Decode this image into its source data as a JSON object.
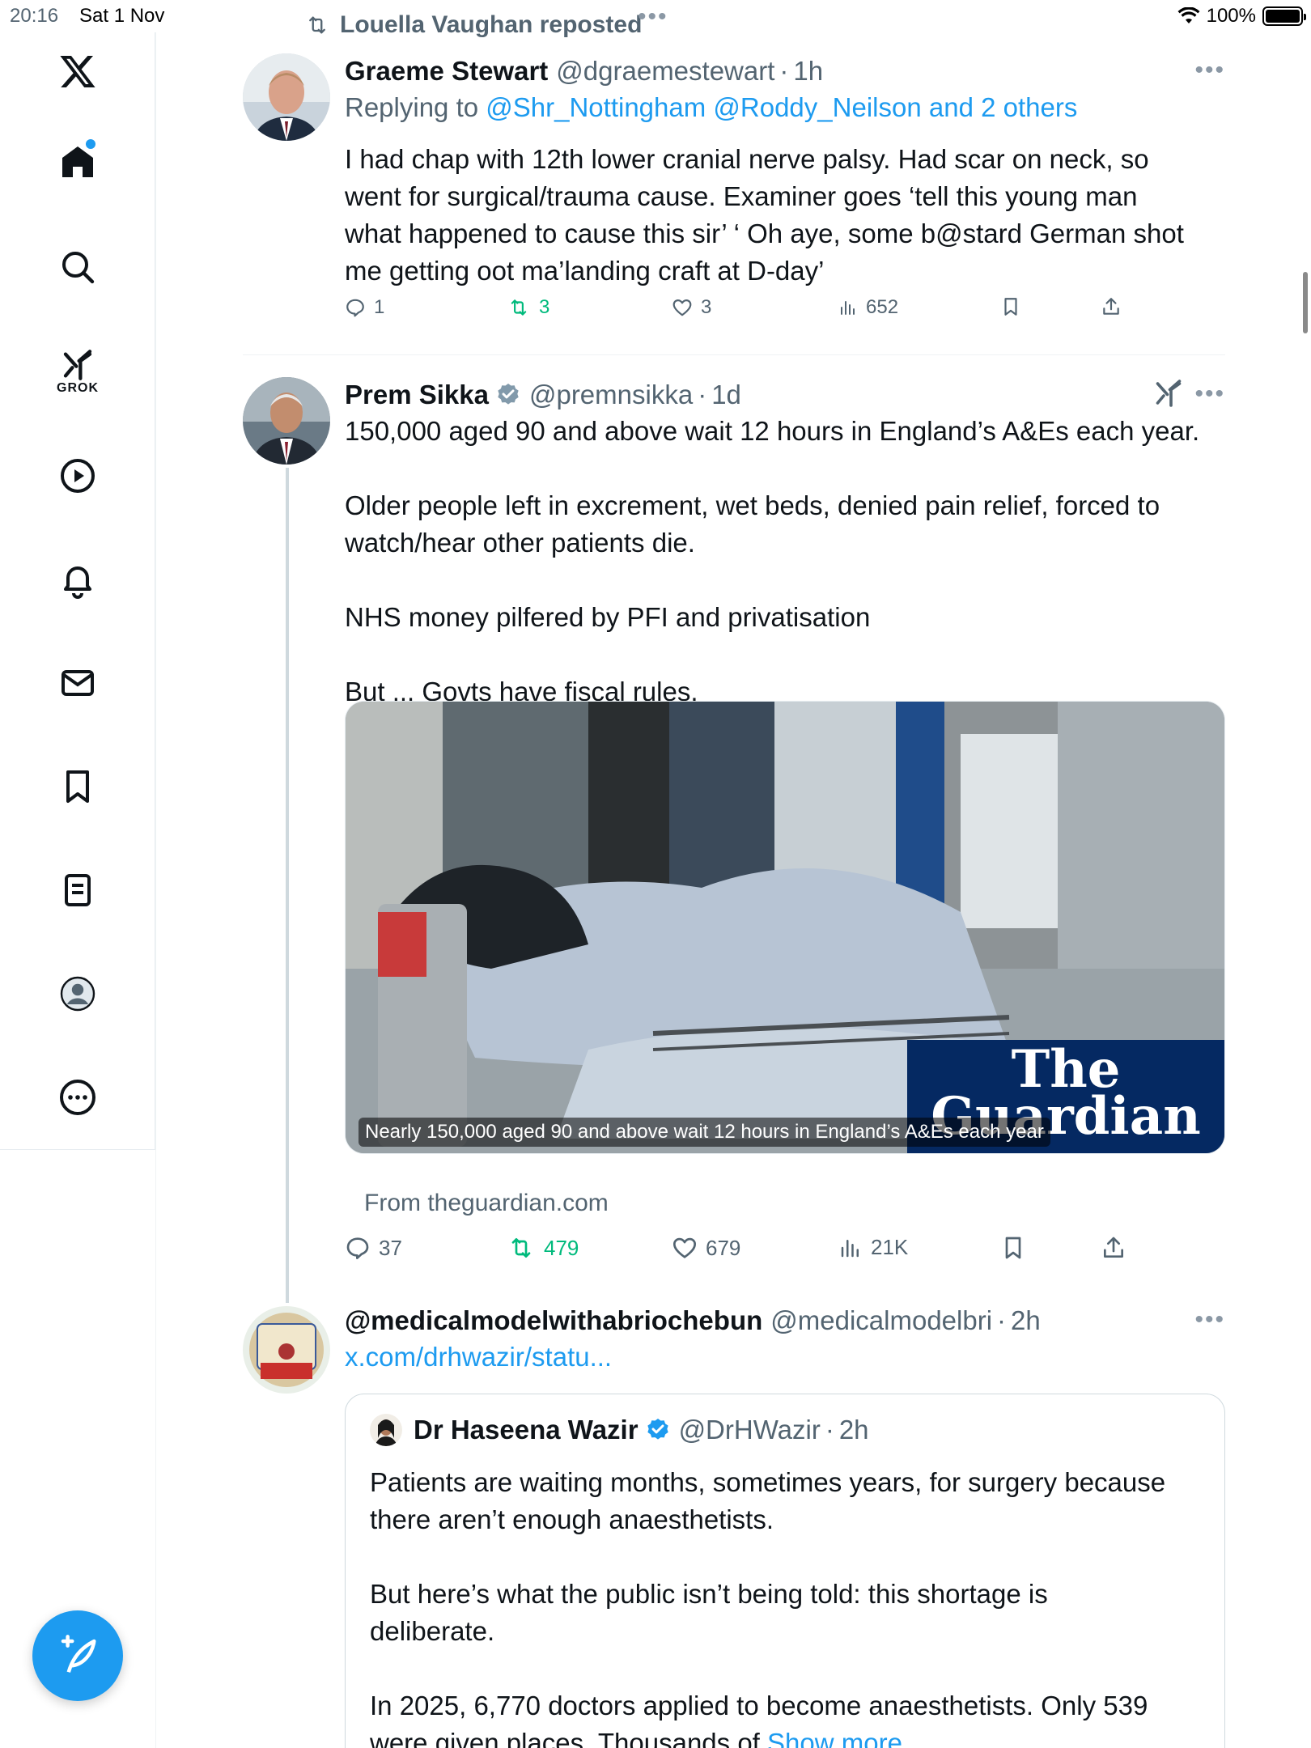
{
  "status_bar": {
    "time": "20:16",
    "date": "Sat 1 Nov",
    "battery": "100%"
  },
  "sidebar": {
    "items": [
      {
        "name": "x-logo"
      },
      {
        "name": "home"
      },
      {
        "name": "search"
      },
      {
        "name": "grok",
        "label": "GROK"
      },
      {
        "name": "videos"
      },
      {
        "name": "notifications"
      },
      {
        "name": "messages"
      },
      {
        "name": "bookmarks"
      },
      {
        "name": "lists"
      },
      {
        "name": "profile"
      },
      {
        "name": "more"
      }
    ]
  },
  "repost": {
    "label": "Louella Vaughan reposted"
  },
  "tweets": [
    {
      "name": "Graeme Stewart",
      "handle": "@dgraemestewart",
      "time": "1h",
      "replying_prefix": "Replying to ",
      "replying_to": "@Shr_Nottingham @Roddy_Neilson and 2 others",
      "body": "I had chap with 12th lower cranial nerve palsy. Had scar on neck, so\nwent for surgical/trauma cause. Examiner goes ‘tell this young man\nwhat happened to cause this sir’ ‘ Oh aye, some b@stard German shot\nme getting oot ma’landing craft at D-day’",
      "replies": "1",
      "reposts": "3",
      "likes": "3",
      "views": "652"
    },
    {
      "name": "Prem Sikka",
      "handle": "@premnsikka",
      "time": "1d",
      "body": "150,000 aged 90 and above wait 12 hours in England’s A&Es each year.\n\nOlder people left in excrement, wet beds, denied pain relief, forced to\nwatch/hear other patients die.\n\nNHS money pilfered by PFI and privatisation\n\nBut ... Govts have fiscal rules.",
      "media_caption": "Nearly 150,000 aged 90 and above wait 12 hours in England’s A&Es each year",
      "media_brand_line1": "The",
      "media_brand_line2": "Guardian",
      "from": "From theguardian.com",
      "replies": "37",
      "reposts": "479",
      "likes": "679",
      "views": "21K"
    },
    {
      "name": "@medicalmodelwithabriochebun",
      "handle": "@medicalmodelbri",
      "time": "2h",
      "link": "x.com/drhwazir/statu...",
      "quote": {
        "name": "Dr Haseena Wazir",
        "handle": "@DrHWazir",
        "time": "2h",
        "body": "Patients are waiting months, sometimes years, for surgery because\nthere aren’t enough anaesthetists.\n\nBut here’s what the public isn’t being told: this shortage is\ndeliberate.\n\nIn 2025, 6,770 doctors applied to become anaesthetists. Only 539\nwere given places. Thousands of ",
        "show_more": "Show more"
      }
    }
  ],
  "colors": {
    "accent": "#1d9bf0",
    "repost_green": "#00ba7c",
    "secondary_text": "#536471",
    "guardian_blue": "#052962"
  }
}
